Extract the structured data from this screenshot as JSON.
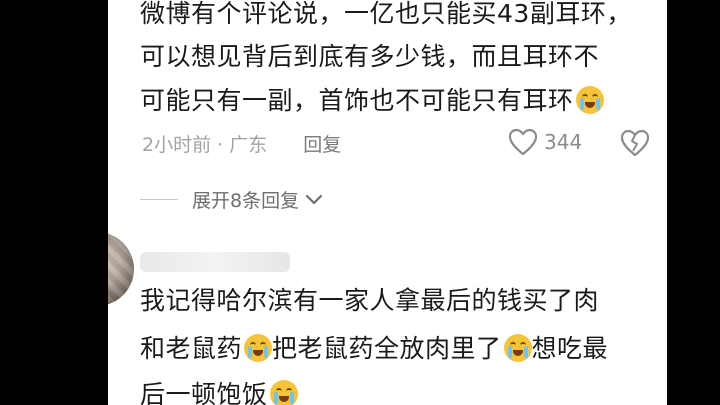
{
  "comment1": {
    "lines": [
      "微博有个评论说，一亿也只能买43副耳环，",
      "可以想见背后到底有多少钱，而且耳环不",
      "可能只有一副，首饰也不可能只有耳环"
    ],
    "emoji": "crying-face",
    "time": "2小时前",
    "sep": "·",
    "location": "广东",
    "reply_label": "回复",
    "likes": "344"
  },
  "expand": {
    "label": "展开8条回复"
  },
  "comment2": {
    "lines": [
      "我记得哈尔滨有一家人拿最后的钱买了肉",
      "和老鼠药",
      "把老鼠药全放肉里了",
      "想吃最",
      "后一顿饱饭"
    ],
    "emoji": "crying-face"
  },
  "colors": {
    "text": "#1a1a1a",
    "meta": "#a3a3a3",
    "emoji": "#f7c437"
  }
}
